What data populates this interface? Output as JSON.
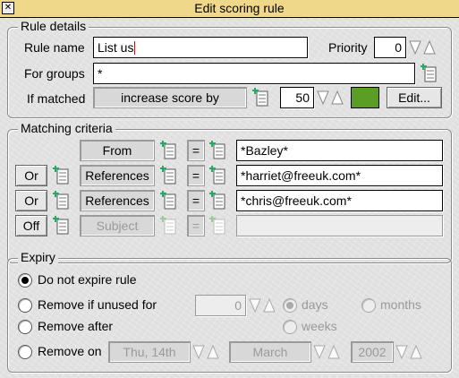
{
  "window": {
    "title": "Edit scoring rule"
  },
  "rule_details": {
    "title": "Rule details",
    "rule_name_label": "Rule name",
    "rule_name_value": "List us",
    "priority_label": "Priority",
    "priority_value": "0",
    "for_groups_label": "For groups",
    "for_groups_value": "*",
    "if_matched_label": "If matched",
    "if_matched_action": "increase score by",
    "score_value": "50",
    "score_color": "#5a9e26",
    "edit_button": "Edit..."
  },
  "matching": {
    "title": "Matching criteria",
    "rows": [
      {
        "combiner": "",
        "header": "From",
        "operator": "=",
        "value": "*Bazley*",
        "enabled": true
      },
      {
        "combiner": "Or",
        "header": "References",
        "operator": "=",
        "value": "*harriet@freeuk.com*",
        "enabled": true
      },
      {
        "combiner": "Or",
        "header": "References",
        "operator": "=",
        "value": "*chris@freeuk.com*",
        "enabled": true
      },
      {
        "combiner": "Off",
        "header": "Subject",
        "operator": "=",
        "value": "",
        "enabled": false
      }
    ]
  },
  "expiry": {
    "title": "Expiry",
    "opt_no_expire": "Do not expire rule",
    "opt_unused": "Remove if unused for",
    "unused_value": "0",
    "unit_days": "days",
    "unit_months": "months",
    "unit_weeks": "weeks",
    "opt_after": "Remove after",
    "opt_on": "Remove on",
    "on_day": "Thu, 14th",
    "on_month": "March",
    "on_year": "2002",
    "selected": "no_expire"
  }
}
